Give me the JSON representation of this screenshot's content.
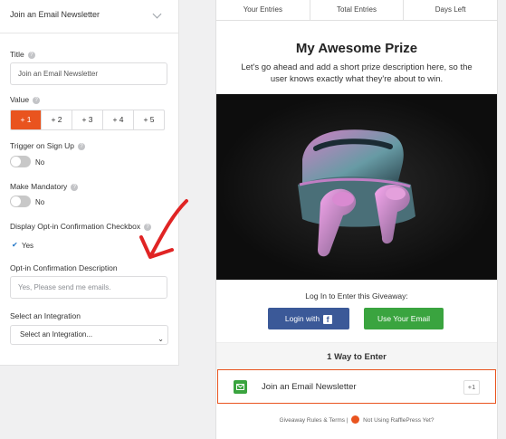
{
  "settings": {
    "section_title": "Join an Email Newsletter",
    "title_label": "Title",
    "title_value": "Join an Email Newsletter",
    "value_label": "Value",
    "value_options": [
      "+ 1",
      "+ 2",
      "+ 3",
      "+ 4",
      "+ 5"
    ],
    "value_selected": "+ 1",
    "trigger_label": "Trigger on Sign Up",
    "trigger_state": "No",
    "mandatory_label": "Make Mandatory",
    "mandatory_state": "No",
    "optin_checkbox_label": "Display Opt-in Confirmation Checkbox",
    "optin_checkbox_state": "Yes",
    "optin_desc_label": "Opt-in Confirmation Description",
    "optin_desc_placeholder": "Yes, Please send me emails.",
    "integration_label": "Select an Integration",
    "integration_value": "Select an Integration..."
  },
  "preview": {
    "stats": [
      "Your Entries",
      "Total Entries",
      "Days Left"
    ],
    "prize_title": "My Awesome Prize",
    "prize_description": "Let's go ahead and add a short prize description here, so the user knows exactly what they're about to win.",
    "login_prompt": "Log In to Enter this Giveaway:",
    "facebook_button": "Login with",
    "email_button": "Use Your Email",
    "ways_title": "1 Way to Enter",
    "entry_label": "Join an Email Newsletter",
    "entry_points": "+1",
    "footer_rules": "Giveaway Rules & Terms |",
    "footer_promo": "Not Using RafflePress Yet?"
  },
  "colors": {
    "accent": "#e9541f",
    "facebook": "#3b5998",
    "green": "#3aa43f"
  }
}
